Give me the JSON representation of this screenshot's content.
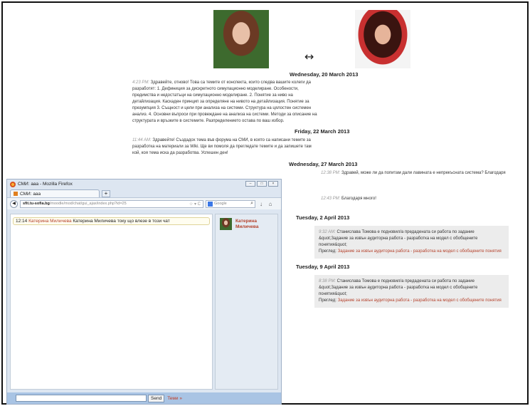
{
  "conversation": {
    "date1": "Wednesday, 20 March 2013",
    "msg1_time": "4:23 PM:",
    "msg1_text": " Здравейте, отново! Това са темите от конспекта, които следва вашите колеги да разработят: 1. Дефиниция за дискретното симулационно моделиране. Особености, предимства и недостатъци на симулационно моделиране. 2. Понятие за ниво на детайлизация. Каскаден принцип за определяне на нивото на детайлизация. Понятие за презумпция 3. Същност и цели при анализа на системи. Структура на цялостен системен анализ. 4. Основни въпроси при провеждане на анализа на системи. Методи за описание на структурата и връзките в системите. Разпределението остава по ваш избор.",
    "date2": "Friday, 22 March 2013",
    "msg2_time": "11:44 AM:",
    "msg2_text": " Здравейте! Създадох тема във форума на СМИ, в която са написани темите за разработка на материали за Wiki. Ще ви помоля да прегледате темите и да запишете там кой, коя тема иска да разработва. Успешен ден!",
    "date3": "Wednesday, 27 March 2013",
    "msg3_time": "12:38 PM:",
    "msg3_text": " Здравей, може ли да попитам дали лавината е непрекъсната система? Благодаря",
    "msg4_time": "12:43 PM:",
    "msg4_text": " Благодаря много!",
    "date4": "Tuesday, 2 April 2013",
    "notif1_time": "9:32 AM:",
    "notif1_text": " Станислава Томова е подновил/а предадената си работа по задание &quot;Задание за извън аудиторна работа - разработка на модел с обобщените понятия&quot;",
    "notif1_review_label": "Преглед: ",
    "notif1_link": "Задание за извън аудиторна работа - разработка на модел с обобщените понятия",
    "date5": "Tuesday, 9 April 2013",
    "notif2_time": "8:38 PM:",
    "notif2_text": " Станислава Томова е подновил/а предадената си работа по задание &quot;Задание за извън аудиторна работа - разработка на модел с обобщените понятия&quot;",
    "notif2_review_label": "Преглед: ",
    "notif2_link": "Задание за извън аудиторна работа - разработка на модел с обобщените понятия"
  },
  "firefox": {
    "window_title": "СМИ: aaa - Mozilla Firefox",
    "tab_label": "СМИ: aaa",
    "new_tab": "+",
    "url_host": "sfit.tu-sofia.bg",
    "url_path": "/moodle/mod/chat/gui_ajax/index.php?id=25",
    "search_placeholder": "Google",
    "chat_time": "12:14 ",
    "chat_user": "Катерина Миличева",
    "chat_message": " Катерина Миличева току що влезе в този чат",
    "user_panel_name": "Катерина Миличева",
    "send_label": "Send",
    "theme_label": "Теми »"
  },
  "swap_arrow": "↔",
  "colors": {
    "link": "#b5422c",
    "notification_bg": "#ececec",
    "firefox_chrome": "#dde6f1",
    "bottom_bar": "#a9c4e4"
  }
}
